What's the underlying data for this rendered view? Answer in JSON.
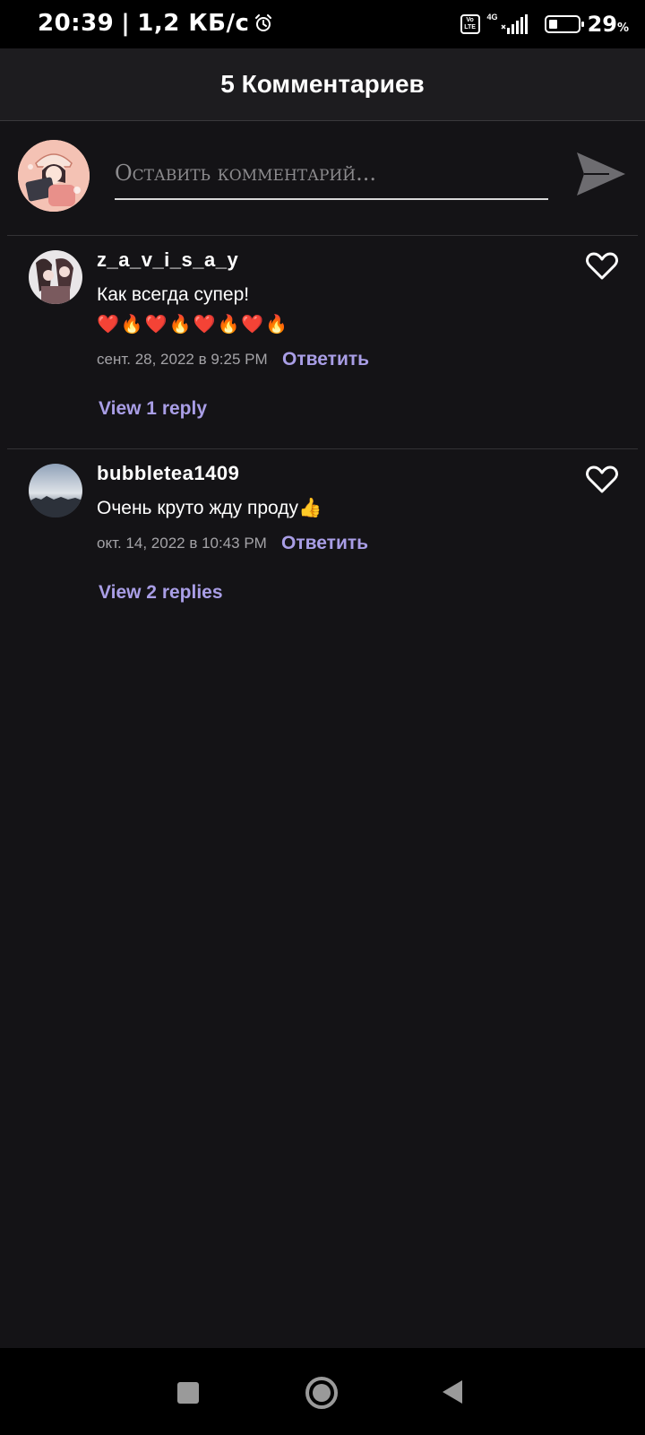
{
  "status_bar": {
    "time": "20:39",
    "separator": "|",
    "data_speed": "1,2 КБ/с",
    "alarm_icon": "alarm-clock-icon",
    "volte_label": "Vo LTE",
    "network_type": "4G",
    "signal_icon": "signal-bars-icon",
    "battery_level": 29,
    "battery_text": "29"
  },
  "header": {
    "title": "5 Комментариев"
  },
  "composer": {
    "placeholder": "Оставить комментарий...",
    "value": "",
    "send_icon": "send-icon"
  },
  "comments": [
    {
      "username": "z_a_v_i_s_a_y",
      "text": "Как всегда супер!",
      "emoji_line": "❤️🔥❤️🔥❤️🔥❤️🔥",
      "timestamp": "сент. 28, 2022 в 9:25 PM",
      "reply_label": "Ответить",
      "view_replies_label": "View 1 reply",
      "liked": false
    },
    {
      "username": "bubbletea1409",
      "text": "Очень круто жду проду👍",
      "timestamp": "окт. 14, 2022 в 10:43 PM",
      "reply_label": "Ответить",
      "view_replies_label": "View 2 replies",
      "liked": false
    }
  ],
  "nav_bar": {
    "recents_icon": "square-recents-icon",
    "home_icon": "circle-home-icon",
    "back_icon": "triangle-back-icon"
  },
  "colors": {
    "background": "#141316",
    "header_background": "#1d1c1f",
    "accent_link": "#a99ee6",
    "muted_text": "#a4a3a7"
  }
}
